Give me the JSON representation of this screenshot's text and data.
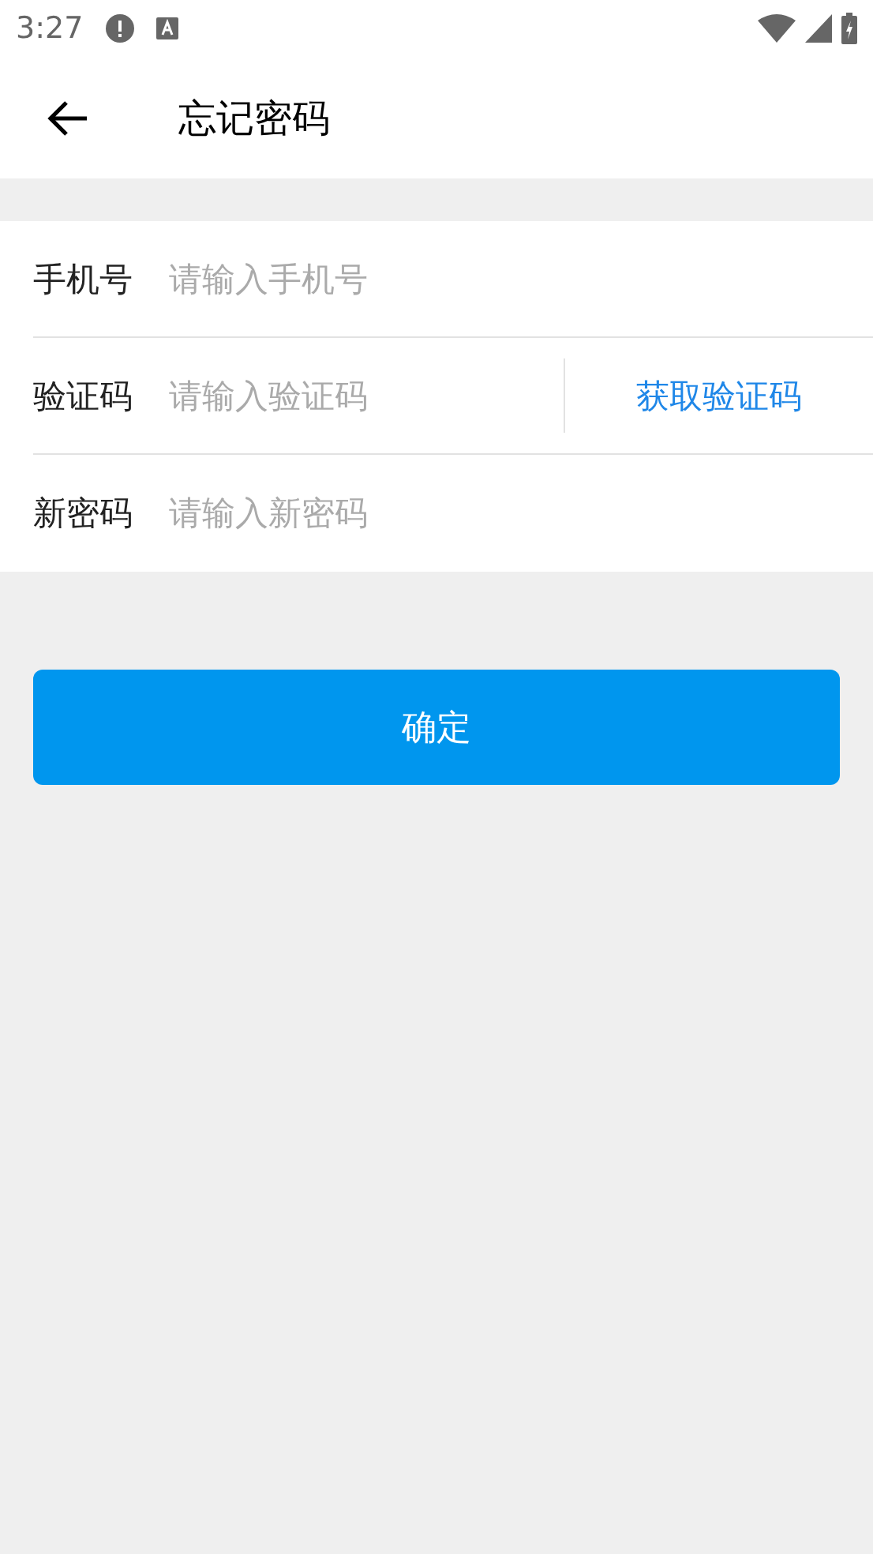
{
  "status_bar": {
    "time": "3:27"
  },
  "app_bar": {
    "title": "忘记密码"
  },
  "fields": [
    {
      "kind": "text",
      "label": "手机号",
      "placeholder": "请输入手机号"
    },
    {
      "kind": "code",
      "label": "验证码",
      "placeholder": "请输入验证码",
      "action": "获取验证码"
    },
    {
      "kind": "text",
      "label": "新密码",
      "placeholder": "请输入新密码"
    }
  ],
  "submit": "确定"
}
